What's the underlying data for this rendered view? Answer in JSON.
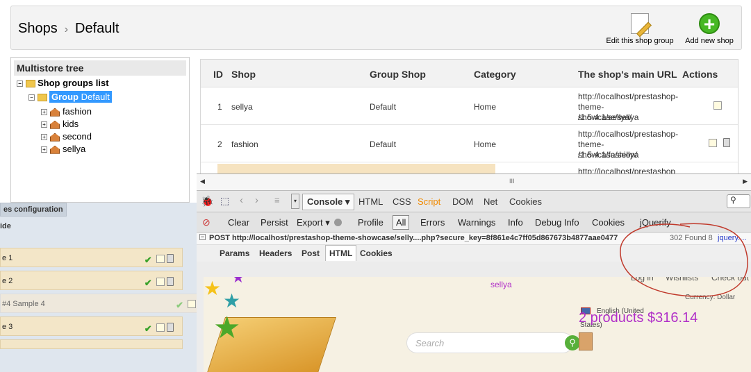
{
  "header": {
    "crumb_root": "Shops",
    "crumb_sep": "›",
    "crumb_current": "Default",
    "edit_group_label": "Edit this shop group",
    "add_shop_label": "Add new shop",
    "add_symbol": "+"
  },
  "tree": {
    "title": "Multistore tree",
    "root": "Shop groups list",
    "group_prefix": "Group",
    "group_name": "Default",
    "shops": [
      "fashion",
      "kids",
      "second",
      "sellya"
    ]
  },
  "table": {
    "headers": {
      "id": "ID",
      "shop": "Shop",
      "group": "Group Shop",
      "category": "Category",
      "url": "The shop's main URL",
      "actions": "Actions"
    },
    "rows": [
      {
        "id": "1",
        "shop": "sellya",
        "group": "Default",
        "category": "Home",
        "url1": "http://localhost/prestashop-",
        "url2": "theme-showcase/sellya",
        "url3": "/1.5.4.1/sellya/"
      },
      {
        "id": "2",
        "shop": "fashion",
        "group": "Default",
        "category": "Home",
        "url1": "http://localhost/prestashop-",
        "url2": "theme-showcase/sellya",
        "url3": "/1.5.4.1/fashion/"
      }
    ],
    "partial_url": "http://localhost/prestashop"
  },
  "left_panel": {
    "tab_label": "es configuration",
    "section_label": "ide",
    "rows": [
      "e 1",
      "e 2",
      "#4 Sample 4",
      "e 3"
    ]
  },
  "firebug": {
    "scroll_mark": "III",
    "tabs": {
      "console": "Console",
      "html": "HTML",
      "css": "CSS",
      "script": "Script",
      "dom": "DOM",
      "net": "Net",
      "cookies": "Cookies"
    },
    "toolbar2": {
      "clear": "Clear",
      "persist": "Persist",
      "export": "Export",
      "profile": "Profile",
      "all": "All",
      "errors": "Errors",
      "warnings": "Warnings",
      "info": "Info",
      "debug": "Debug Info",
      "cookies": "Cookies",
      "jquerify": "jQuerify"
    },
    "request": {
      "method": "POST",
      "url": "http://localhost/prestashop-theme-showcase/selly....php?secure_key=8f861e4c7ff05d867673b4877aae0477",
      "status": "302 Found",
      "count": "8",
      "source": "jquery...."
    },
    "subtabs": {
      "params": "Params",
      "headers": "Headers",
      "post": "Post",
      "html": "HTML",
      "cookies": "Cookies"
    }
  },
  "preview": {
    "shop_name": "sellya",
    "login": "Log in",
    "wishlists": "Wishlists",
    "checkout": "Check out",
    "currency": "Currency: Dollar",
    "language": "English (United",
    "language2": "States)",
    "cart": "2 products $316.14",
    "search_placeholder": "Search"
  },
  "colors": {
    "selection": "#3399ff",
    "script_tab": "#f08a00",
    "cart_text": "#b02fc8",
    "annotation": "#c0392b"
  }
}
